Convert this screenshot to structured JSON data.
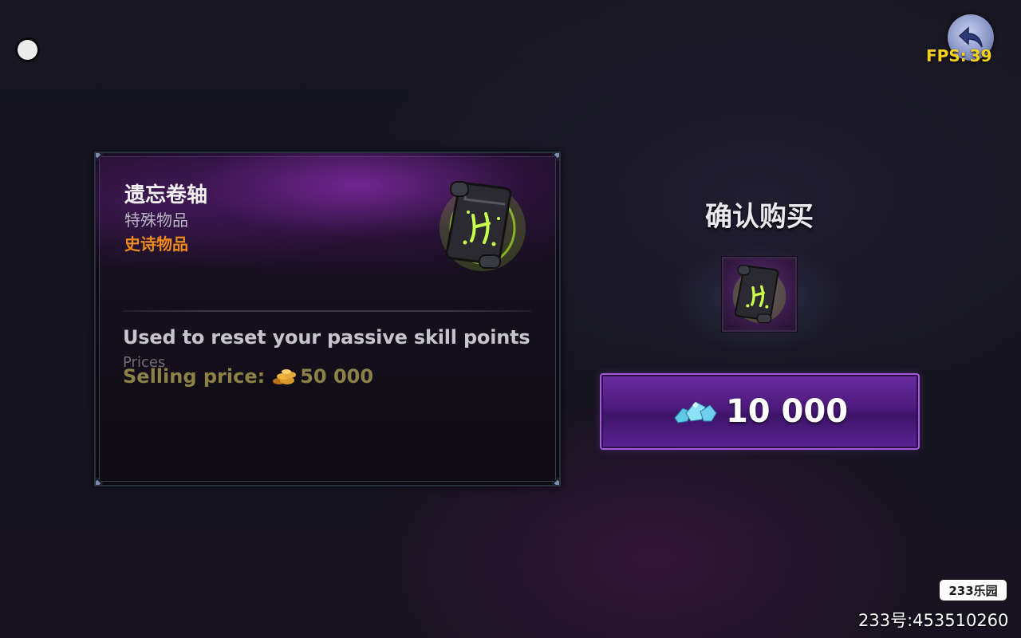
{
  "hud": {
    "fps_label": "FPS:",
    "fps_value": "39",
    "back_icon": "back-arrow-icon",
    "status_dot_icon": "white-dot-icon"
  },
  "item_card": {
    "name": "遗忘卷轴",
    "type": "特殊物品",
    "rarity": "史诗物品",
    "rarity_color": "#f08a1d",
    "icon": "scroll-icon",
    "description": "Used to reset your passive skill points",
    "prices_label": "Prices",
    "selling_label": "Selling price:",
    "selling_currency_icon": "gold-coins-icon",
    "selling_value": "50 000"
  },
  "confirm": {
    "title": "确认购买",
    "item_icon": "scroll-icon",
    "buy_currency_icon": "crystal-gems-icon",
    "buy_price": "10 000",
    "button_color": "#5a2395"
  },
  "watermark": {
    "logo_text": "233乐园",
    "id_text": "233号:453510260"
  }
}
